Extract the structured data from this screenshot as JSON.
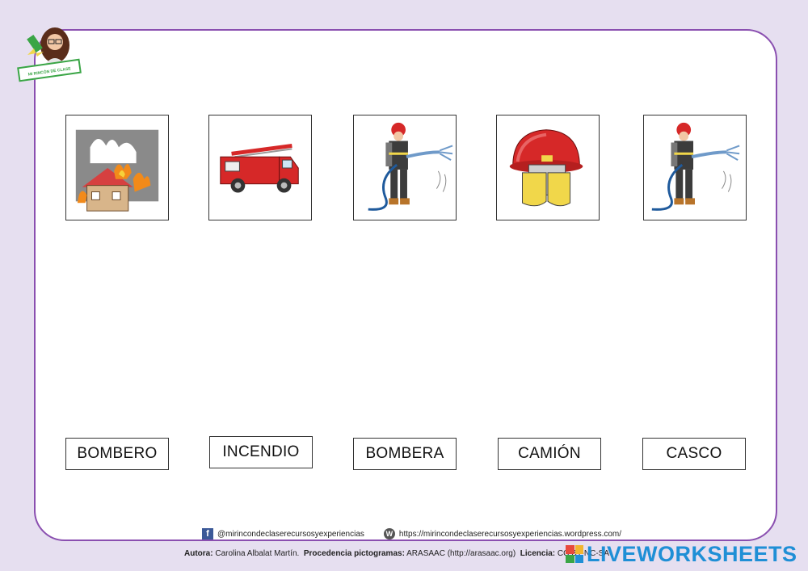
{
  "logo": {
    "text": "MI RINCÓN DE CLASE"
  },
  "cards": [
    {
      "icon": "burning-house-icon"
    },
    {
      "icon": "fire-truck-icon"
    },
    {
      "icon": "firefighter-hose-icon"
    },
    {
      "icon": "fire-helmet-icon"
    },
    {
      "icon": "firefighter-hose-icon"
    }
  ],
  "labels": [
    "BOMBERO",
    "INCENDIO",
    "BOMBERA",
    "CAMIÓN",
    "CASCO"
  ],
  "footer": {
    "facebook": "@mirincondeclaserecursosyexperiencias",
    "website": "https://mirincondeclaserecursosyexperiencias.wordpress.com/",
    "author_label": "Autora:",
    "author": "Carolina Albalat Martín.",
    "source_label": "Procedencia pictogramas:",
    "source": "ARASAAC (http://arasaac.org)",
    "license_label": "Licencia:",
    "license": "CC BY-NC-SA"
  },
  "brand": {
    "text": "LIVEWORKSHEETS",
    "color": "#1f8fd6"
  }
}
